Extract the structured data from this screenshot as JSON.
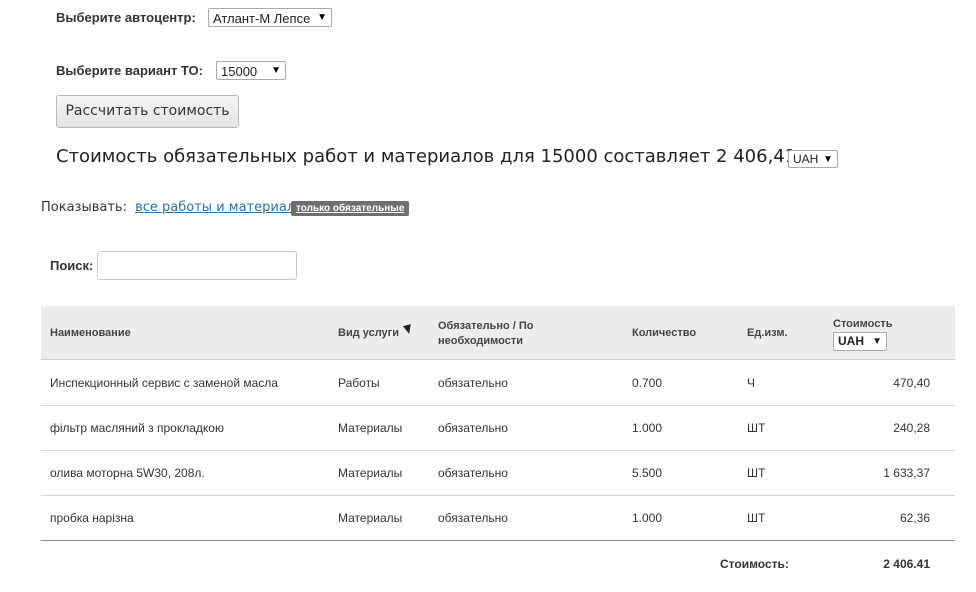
{
  "center": {
    "label": "Выберите автоцентр:",
    "value": "Атлант-М Лепсе"
  },
  "variant": {
    "label": "Выберите вариант ТО:",
    "value": "15000"
  },
  "calc_button": "Рассчитать стоимость",
  "result": {
    "text": "Стоимость обязательных работ и материалов для 15000 составляет 2 406,41",
    "currency": "UAH"
  },
  "filter": {
    "label": "Показывать:",
    "all_link": "все работы и материалы",
    "mandatory_badge": "только обязательные"
  },
  "search": {
    "label": "Поиск:",
    "value": ""
  },
  "table": {
    "headers": {
      "name": "Наименование",
      "service_type": "Вид услуги",
      "mandatory_line1": "Обязательно / По",
      "mandatory_line2": "необходимости",
      "quantity": "Количество",
      "unit": "Ед.изм.",
      "cost": "Стоимость",
      "cost_currency": "UAH"
    },
    "rows": [
      {
        "name": "Инспекционный сервис с заменой масла",
        "service_type": "Работы",
        "mandatory": "обязательно",
        "quantity": "0.700",
        "unit": "Ч",
        "cost": "470,40"
      },
      {
        "name": "фільтр масляний з прокладкою",
        "service_type": "Материалы",
        "mandatory": "обязательно",
        "quantity": "1.000",
        "unit": "ШТ",
        "cost": "240,28"
      },
      {
        "name": "олива моторна 5W30, 208л.",
        "service_type": "Материалы",
        "mandatory": "обязательно",
        "quantity": "5.500",
        "unit": "ШТ",
        "cost": "1 633,37"
      },
      {
        "name": "пробка нарізна",
        "service_type": "Материалы",
        "mandatory": "обязательно",
        "quantity": "1.000",
        "unit": "ШТ",
        "cost": "62,36"
      }
    ],
    "total_label": "Стоимость:",
    "total_value": "2 406.41"
  },
  "icons": {
    "dropdown": "caret-down-icon",
    "sort": "sort-desc-icon"
  },
  "colors": {
    "link": "#2a6fa8",
    "badge_bg": "#6f6f6f",
    "header_bg": "#ededed"
  }
}
